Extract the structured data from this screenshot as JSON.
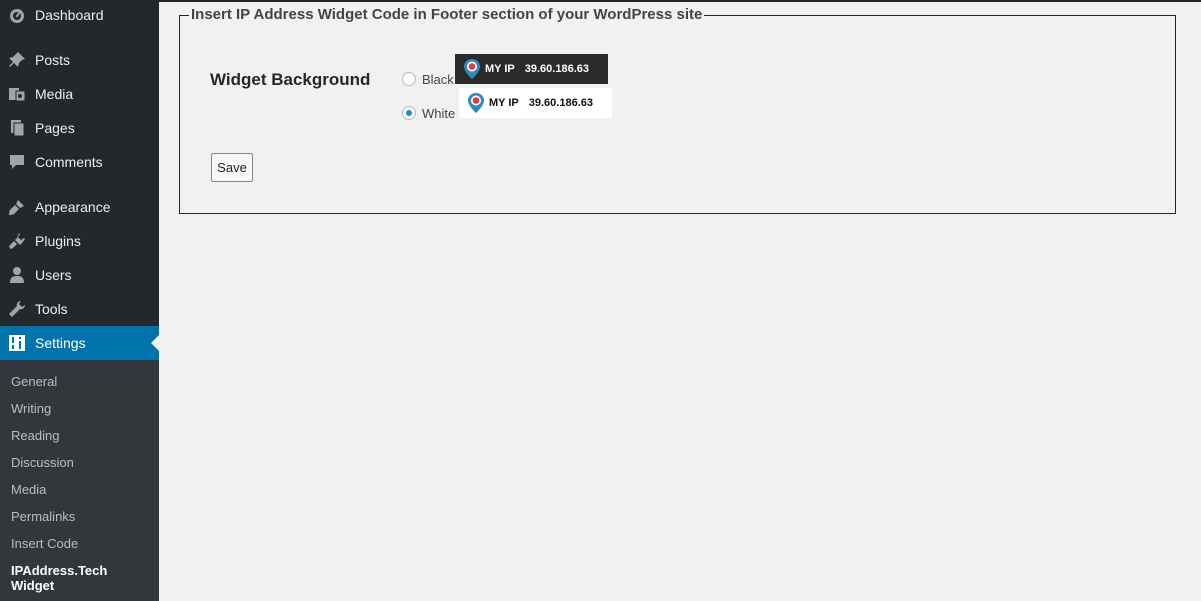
{
  "sidebar": {
    "menu": [
      {
        "label": "Dashboard",
        "icon": "dashboard-icon"
      },
      {
        "label": "Posts",
        "icon": "pin-icon"
      },
      {
        "label": "Media",
        "icon": "media-icon"
      },
      {
        "label": "Pages",
        "icon": "pages-icon"
      },
      {
        "label": "Comments",
        "icon": "comments-icon"
      },
      {
        "label": "Appearance",
        "icon": "brush-icon"
      },
      {
        "label": "Plugins",
        "icon": "plugin-icon"
      },
      {
        "label": "Users",
        "icon": "user-icon"
      },
      {
        "label": "Tools",
        "icon": "wrench-icon"
      },
      {
        "label": "Settings",
        "icon": "settings-icon",
        "active": true
      }
    ],
    "submenu": [
      "General",
      "Writing",
      "Reading",
      "Discussion",
      "Media",
      "Permalinks",
      "Insert Code",
      "IPAddress.Tech Widget"
    ],
    "current_submenu": "IPAddress.Tech Widget"
  },
  "main": {
    "legend": "Insert IP Address Widget Code in Footer section of your WordPress site",
    "widget_background_label": "Widget Background",
    "options": [
      {
        "label": "Black",
        "checked": false,
        "preview": {
          "tag": "MY IP",
          "ip": "39.60.186.63",
          "background": "#2b2b2b"
        }
      },
      {
        "label": "White",
        "checked": true,
        "preview": {
          "tag": "MY IP",
          "ip": "39.60.186.63",
          "background": "#ffffff"
        }
      }
    ],
    "save_label": "Save"
  },
  "colors": {
    "sidebar_bg": "#23282d",
    "submenu_bg": "#32373c",
    "accent": "#0073aa",
    "page_bg": "#f1f1f1"
  }
}
